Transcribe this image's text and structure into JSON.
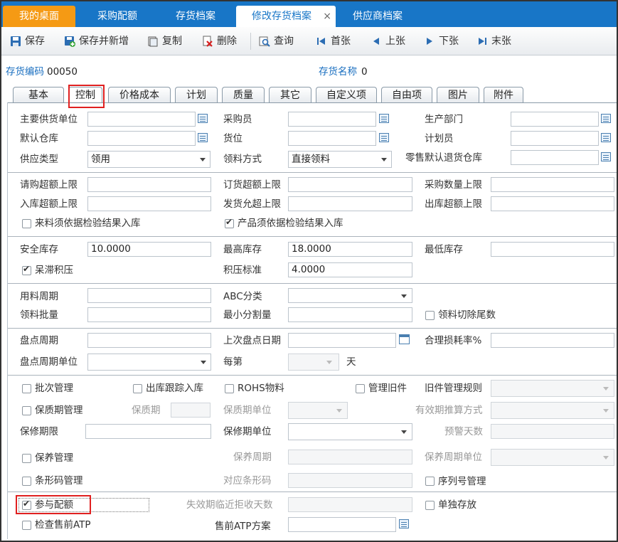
{
  "tabs": [
    "我的桌面",
    "采购配额",
    "存货档案",
    "修改存货档案",
    "供应商档案"
  ],
  "tab_close": "×",
  "toolbar": {
    "save": "保存",
    "save_new": "保存并新增",
    "copy": "复制",
    "delete": "删除",
    "query": "查询",
    "first": "首张",
    "prev": "上张",
    "next": "下张",
    "last": "末张"
  },
  "header": {
    "code_label": "存货编码",
    "code_value": "00050",
    "name_label": "存货名称",
    "name_value": "0"
  },
  "form_tabs": [
    "基本",
    "控制",
    "价格成本",
    "计划",
    "质量",
    "其它",
    "自定义项",
    "自由项",
    "图片",
    "附件"
  ],
  "sec1": {
    "main_supplier": "主要供货单位",
    "buyer": "采购员",
    "production_dept": "生产部门",
    "default_warehouse": "默认仓库",
    "location": "货位",
    "planner": "计划员",
    "supply_type": "供应类型",
    "supply_type_value": "领用",
    "pick_method": "领料方式",
    "pick_method_value": "直接领料",
    "retail_return_wh": "零售默认退货仓库"
  },
  "sec2": {
    "purchase_over": "请购超额上限",
    "order_over": "订货超额上限",
    "purchase_qty_limit": "采购数量上限",
    "inbound_over": "入库超额上限",
    "ship_allow": "发货允超上限",
    "outbound_over": "出库超额上限",
    "incoming_inspect": "来料须依据检验结果入库",
    "product_inspect": "产品须依据检验结果入库"
  },
  "sec3": {
    "safety_stock": "安全库存",
    "safety_stock_value": "10.0000",
    "max_stock": "最高库存",
    "max_stock_value": "18.0000",
    "min_stock": "最低库存",
    "stagnant": "呆滞积压",
    "stagnant_std": "积压标准",
    "stagnant_std_value": "4.0000"
  },
  "sec4": {
    "usage_cycle": "用料周期",
    "abc": "ABC分类",
    "pick_batch": "领料批量",
    "min_split": "最小分割量",
    "cut_tail": "领料切除尾数"
  },
  "sec5": {
    "count_cycle": "盘点周期",
    "last_count_date": "上次盘点日期",
    "loss_rate": "合理损耗率%",
    "count_cycle_unit": "盘点周期单位",
    "every_nth": "每第",
    "day": "天"
  },
  "sec6": {
    "batch_mgmt": "批次管理",
    "outbound_trace": "出库跟踪入库",
    "rohs": "ROHS物料",
    "old_part_mgmt": "管理旧件",
    "old_part_rule": "旧件管理规则",
    "shelf_life_mgmt": "保质期管理",
    "shelf_life": "保质期",
    "shelf_life_unit": "保质期单位",
    "expiry_calc": "有效期推算方式",
    "warranty_limit": "保修期限",
    "warranty_unit": "保修期单位",
    "warning_days": "预警天数",
    "maintenance_mgmt": "保养管理",
    "maintenance_cycle": "保养周期",
    "maintenance_cycle_unit": "保养周期单位",
    "barcode_mgmt": "条形码管理",
    "barcode": "对应条形码",
    "serial_mgmt": "序列号管理"
  },
  "sec7": {
    "quota": "参与配额",
    "expiry_reject_days": "失效期临近拒收天数",
    "separate_storage": "单独存放",
    "check_atp": "检查售前ATP",
    "atp_plan": "售前ATP方案"
  }
}
